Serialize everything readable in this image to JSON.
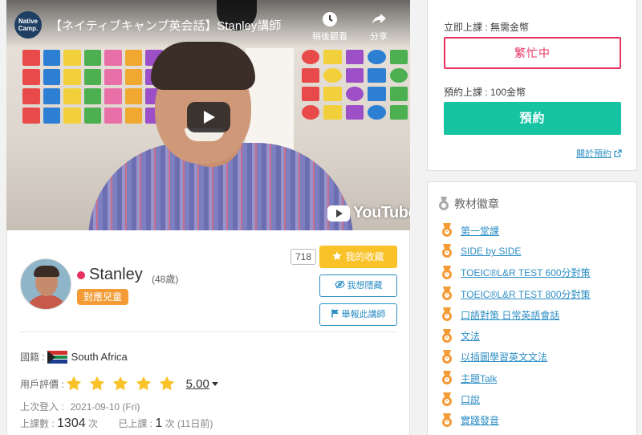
{
  "video": {
    "logo_text": "Native Camp.",
    "title": "【ネイティブキャンプ英会話】Stanley講師",
    "watch_later_label": "稍後觀看",
    "share_label": "分享",
    "brand": "YouTube"
  },
  "tutor": {
    "name": "Stanley",
    "age": "(48歲)",
    "kids_badge": "對應兒童",
    "favorite_count": "718",
    "favorite_button": "我的收藏",
    "hide_button": "我想隱藏",
    "report_button": "舉報此講師",
    "nationality_label": "國籍 :",
    "nationality": "South Africa",
    "rating_label": "用戶評價 :",
    "rating": 5.0,
    "rating_text": "5.00",
    "last_login_label": "上次登入 :",
    "last_login": "2021-09-10 (Fri)",
    "lesson_count_label": "上課數 :",
    "lesson_count": "1304",
    "lesson_unit": "次",
    "taken_label": "已上課 :",
    "taken_count": "1",
    "taken_unit": "次",
    "taken_ago": "(11日前)"
  },
  "booking": {
    "instant_label": "立即上課 : 無需金幣",
    "busy_button": "繁忙中",
    "reserve_label": "預約上課 : 100金幣",
    "reserve_button": "預約",
    "about_link": "關於預約"
  },
  "badges": {
    "title": "教材徽章",
    "items": [
      "第一堂課",
      "SIDE by SIDE",
      "TOEIC®L&R TEST 600分對策",
      "TOEIC®L&R TEST 800分對策",
      "口語對策 日常英語會話",
      "文法",
      "以插圖學習英文文法",
      "主題Talk",
      "口說",
      "實踐發音"
    ]
  },
  "colors": {
    "accent_pink": "#e8315f",
    "accent_green": "#16c4a4",
    "star_yellow": "#f9c229",
    "badge_orange": "#f49b36",
    "link_blue": "#2e8fc5"
  }
}
